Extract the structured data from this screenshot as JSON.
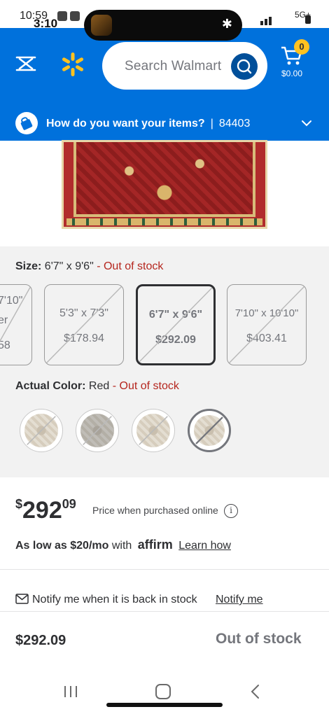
{
  "status_bar": {
    "time_primary": "10:59",
    "time_overlay": "3:10",
    "network": "5G+"
  },
  "header": {
    "search_placeholder": "Search Walmart",
    "cart_count": "0",
    "cart_total": "$0.00",
    "delivery_prompt": "How do you want your items?",
    "delivery_separator": "|",
    "zip_code": "84403",
    "brand_color": "#0071dc",
    "spark_color": "#ffc220"
  },
  "size_section": {
    "label": "Size:",
    "selected_value": "6'7\" x 9'6\"",
    "status": "- Out of stock",
    "options": [
      {
        "dimension": "7'10\"",
        "price": "er",
        "extra": "58"
      },
      {
        "dimension": "5'3\" x 7'3\"",
        "price": "$178.94"
      },
      {
        "dimension": "6'7\" x 9'6\"",
        "price": "$292.09",
        "selected": true
      },
      {
        "dimension": "7'10\" x 10'10\"",
        "price": "$403.41"
      }
    ]
  },
  "color_section": {
    "label": "Actual Color:",
    "selected_value": "Red",
    "status": "- Out of stock",
    "swatch_count": 4
  },
  "price": {
    "currency": "$",
    "whole": "292",
    "cents": "09",
    "note": "Price when purchased online",
    "info_glyph": "i"
  },
  "affirm": {
    "prefix": "As low as $20/mo",
    "with": "with",
    "logo": "affirm",
    "link": "Learn how"
  },
  "notify": {
    "text": "Notify me when it is back in stock",
    "link": "Notify me"
  },
  "bottom_bar": {
    "price": "$292.09",
    "status": "Out of stock"
  }
}
